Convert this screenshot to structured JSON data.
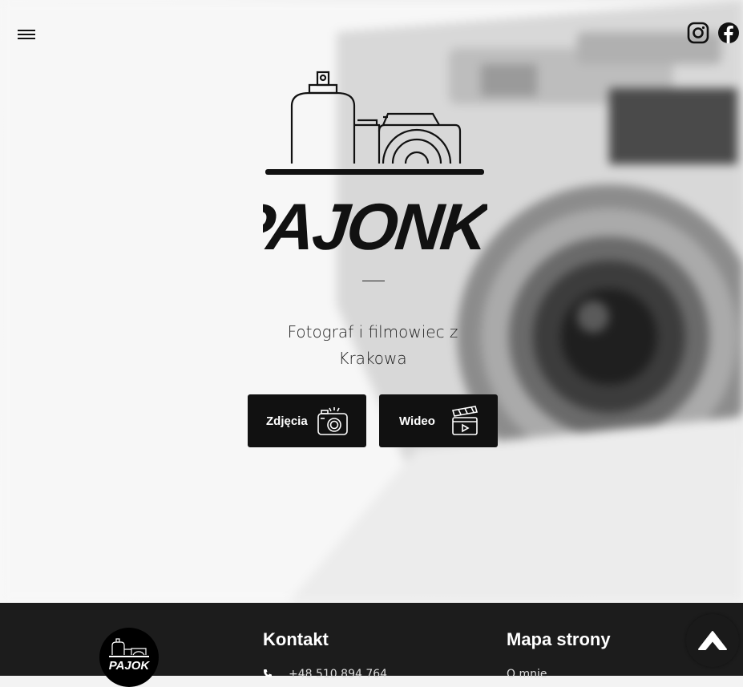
{
  "brand": {
    "logo_text": "PAJONK"
  },
  "hero": {
    "tagline_line1": "Fotograf i filmowiec z",
    "tagline_line2": "Krakowa",
    "buttons": [
      {
        "label": "Zdjęcia",
        "icon": "camera-icon"
      },
      {
        "label": "Wideo",
        "icon": "clapperboard-icon"
      }
    ]
  },
  "social": {
    "items": [
      "instagram-icon",
      "facebook-icon"
    ]
  },
  "footer": {
    "logo_text": "PAJOK",
    "contact": {
      "heading": "Kontakt",
      "phone": "+48 510 894 764"
    },
    "sitemap": {
      "heading": "Mapa strony",
      "first_link": "O mnie"
    }
  },
  "colors": {
    "dark": "#111111",
    "footer_bg": "#1c1c1c",
    "text": "#222222"
  }
}
